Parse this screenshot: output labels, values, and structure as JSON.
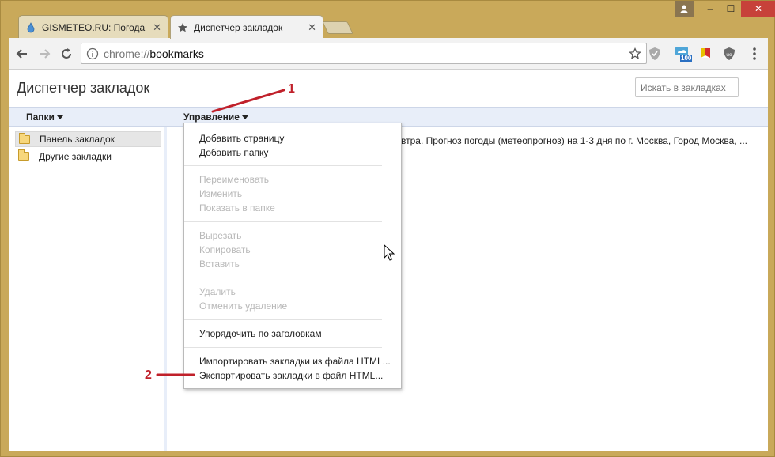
{
  "tabs": [
    {
      "title": "GISMETEO.RU: Погода в",
      "close": "✕",
      "active": false
    },
    {
      "title": "Диспетчер закладок",
      "close": "✕",
      "active": true
    }
  ],
  "window": {
    "user_icon": "user-icon",
    "minimize": "–",
    "maximize": "☐",
    "close": "✕"
  },
  "toolbar": {
    "omnibox": {
      "scheme": "chrome://",
      "host": "bookmarks"
    },
    "extension_badge": "100"
  },
  "page": {
    "title": "Диспетчер закладок",
    "search_placeholder": "Искать в закладках",
    "folders_header": "Папки",
    "manage_header": "Управление",
    "tree": [
      {
        "label": "Панель закладок",
        "selected": true
      },
      {
        "label": "Другие закладки",
        "selected": false
      }
    ],
    "bookmark_text": "втра. Прогноз погоды (метеопрогноз) на 1-3 дня по г. Москва, Город Москва, ..."
  },
  "menu": {
    "groups": [
      [
        {
          "label": "Добавить страницу",
          "enabled": true
        },
        {
          "label": "Добавить папку",
          "enabled": true
        }
      ],
      [
        {
          "label": "Переименовать",
          "enabled": false
        },
        {
          "label": "Изменить",
          "enabled": false
        },
        {
          "label": "Показать в папке",
          "enabled": false
        }
      ],
      [
        {
          "label": "Вырезать",
          "enabled": false
        },
        {
          "label": "Копировать",
          "enabled": false
        },
        {
          "label": "Вставить",
          "enabled": false
        }
      ],
      [
        {
          "label": "Удалить",
          "enabled": false
        },
        {
          "label": "Отменить удаление",
          "enabled": false
        }
      ],
      [
        {
          "label": "Упорядочить по заголовкам",
          "enabled": true
        }
      ],
      [
        {
          "label": "Импортировать закладки из файла HTML...",
          "enabled": true
        },
        {
          "label": "Экспортировать закладки в файл HTML...",
          "enabled": true
        }
      ]
    ]
  },
  "annotations": {
    "one": "1",
    "two": "2",
    "color": "#c0202a"
  }
}
